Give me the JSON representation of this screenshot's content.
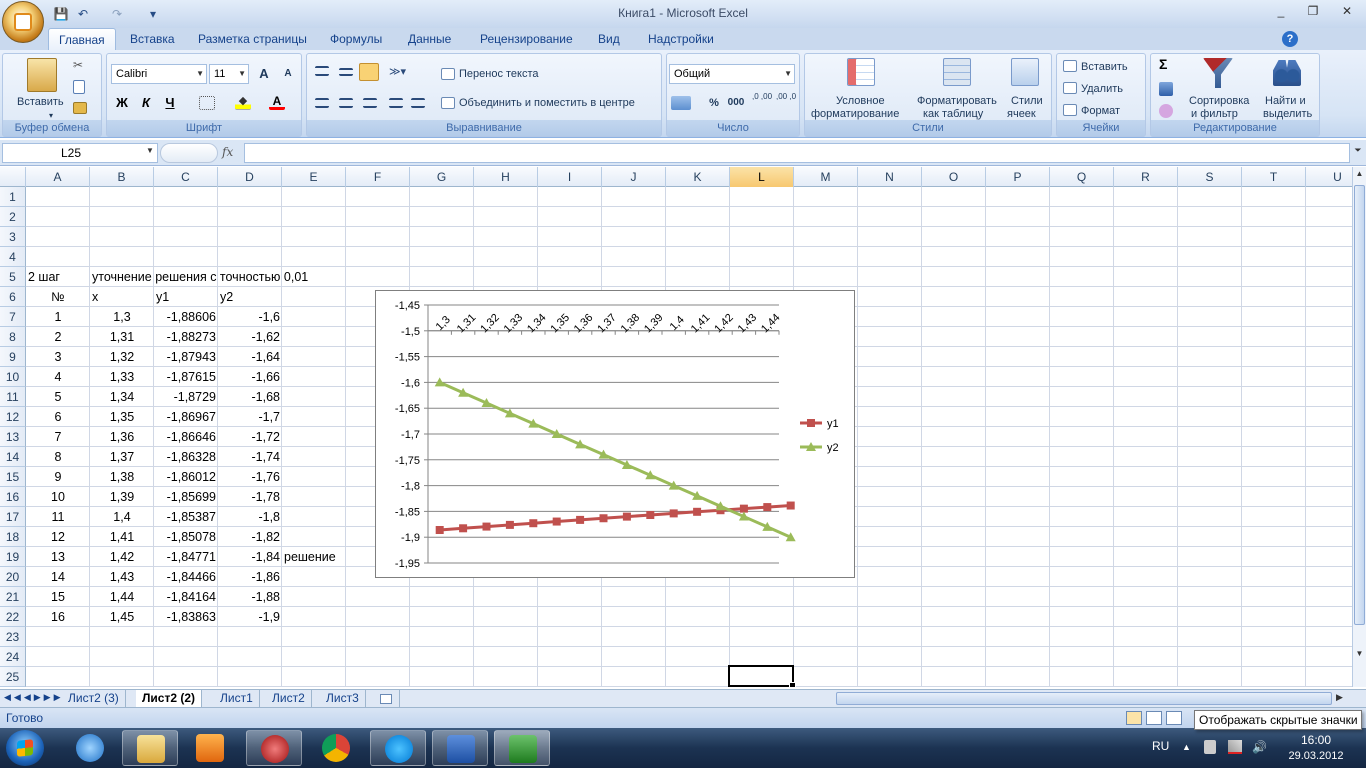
{
  "window": {
    "title": "Книга1 - Microsoft Excel",
    "minimize": "_",
    "restore": "❐",
    "close": "✕"
  },
  "qat": {
    "save": "💾",
    "undo": "↶",
    "redo": "↷",
    "customize": "▾"
  },
  "tabs": [
    "Главная",
    "Вставка",
    "Разметка страницы",
    "Формулы",
    "Данные",
    "Рецензирование",
    "Вид",
    "Надстройки"
  ],
  "ribbon": {
    "clipboard": {
      "label": "Буфер обмена",
      "paste": "Вставить"
    },
    "font": {
      "label": "Шрифт",
      "name": "Calibri",
      "size": "11",
      "grow": "A",
      "shrink": "A",
      "bold": "Ж",
      "italic": "К",
      "underline": "Ч"
    },
    "alignment": {
      "label": "Выравнивание",
      "wrap": "Перенос текста",
      "merge": "Объединить и поместить в центре"
    },
    "number": {
      "label": "Число",
      "format": "Общий",
      "percent": "%",
      "thousands": "000",
      "inc": ",0 ,00",
      "dec": ",00 ,0"
    },
    "styles": {
      "label": "Стили",
      "conditional_1": "Условное",
      "conditional_2": "форматирование",
      "table_1": "Форматировать",
      "table_2": "как таблицу",
      "cell_1": "Стили",
      "cell_2": "ячеек"
    },
    "cells": {
      "label": "Ячейки",
      "insert": "Вставить",
      "delete": "Удалить",
      "format": "Формат"
    },
    "editing": {
      "label": "Редактирование",
      "sort_1": "Сортировка",
      "sort_2": "и фильтр",
      "find_1": "Найти и",
      "find_2": "выделить",
      "sigma": "Σ"
    }
  },
  "formula_bar": {
    "name_box": "L25",
    "fx": "fx",
    "formula": ""
  },
  "columns": [
    "A",
    "B",
    "C",
    "D",
    "E",
    "F",
    "G",
    "H",
    "I",
    "J",
    "K",
    "L",
    "M",
    "N",
    "O",
    "P",
    "Q",
    "R",
    "S",
    "T",
    "U"
  ],
  "rows": [
    "1",
    "2",
    "3",
    "4",
    "5",
    "6",
    "7",
    "8",
    "9",
    "10",
    "11",
    "12",
    "13",
    "14",
    "15",
    "16",
    "17",
    "18",
    "19",
    "20",
    "21",
    "22",
    "23",
    "24",
    "25"
  ],
  "selected_column": "L",
  "sheet": {
    "a5": "2 шаг",
    "b5": "уточнение решения с точностью 0,01",
    "h_no": "№",
    "h_x": "x",
    "h_y1": "y1",
    "h_y2": "y2",
    "table": [
      [
        "1",
        "1,3",
        "-1,88606",
        "-1,6"
      ],
      [
        "2",
        "1,31",
        "-1,88273",
        "-1,62"
      ],
      [
        "3",
        "1,32",
        "-1,87943",
        "-1,64"
      ],
      [
        "4",
        "1,33",
        "-1,87615",
        "-1,66"
      ],
      [
        "5",
        "1,34",
        "-1,8729",
        "-1,68"
      ],
      [
        "6",
        "1,35",
        "-1,86967",
        "-1,7"
      ],
      [
        "7",
        "1,36",
        "-1,86646",
        "-1,72"
      ],
      [
        "8",
        "1,37",
        "-1,86328",
        "-1,74"
      ],
      [
        "9",
        "1,38",
        "-1,86012",
        "-1,76"
      ],
      [
        "10",
        "1,39",
        "-1,85699",
        "-1,78"
      ],
      [
        "11",
        "1,4",
        "-1,85387",
        "-1,8"
      ],
      [
        "12",
        "1,41",
        "-1,85078",
        "-1,82"
      ],
      [
        "13",
        "1,42",
        "-1,84771",
        "-1,84"
      ],
      [
        "14",
        "1,43",
        "-1,84466",
        "-1,86"
      ],
      [
        "15",
        "1,44",
        "-1,84164",
        "-1,88"
      ],
      [
        "16",
        "1,45",
        "-1,83863",
        "-1,9"
      ]
    ],
    "e19": "решение"
  },
  "chart_data": {
    "type": "line",
    "title": "",
    "xlabel": "",
    "ylabel": "",
    "categories": [
      "1,3",
      "1,31",
      "1,32",
      "1,33",
      "1,34",
      "1,35",
      "1,36",
      "1,37",
      "1,38",
      "1,39",
      "1,4",
      "1,41",
      "1,42",
      "1,43",
      "1,44"
    ],
    "series": [
      {
        "name": "y1",
        "color": "#c0504d",
        "marker": "square",
        "values": [
          -1.88606,
          -1.88273,
          -1.87943,
          -1.87615,
          -1.8729,
          -1.86967,
          -1.86646,
          -1.86328,
          -1.86012,
          -1.85699,
          -1.85387,
          -1.85078,
          -1.84771,
          -1.84466,
          -1.84164,
          -1.83863
        ]
      },
      {
        "name": "y2",
        "color": "#9bbb59",
        "marker": "triangle",
        "values": [
          -1.6,
          -1.62,
          -1.64,
          -1.66,
          -1.68,
          -1.7,
          -1.72,
          -1.74,
          -1.76,
          -1.78,
          -1.8,
          -1.82,
          -1.84,
          -1.86,
          -1.88,
          -1.9
        ]
      }
    ],
    "ylim": [
      -1.95,
      -1.45
    ],
    "ytick_step": 0.05,
    "yticks": [
      "-1,45",
      "-1,5",
      "-1,55",
      "-1,6",
      "-1,65",
      "-1,7",
      "-1,75",
      "-1,8",
      "-1,85",
      "-1,9",
      "-1,95"
    ],
    "grid": true,
    "x_axis_position": "top",
    "legend": "right"
  },
  "sheet_tabs": [
    "Лист2 (3)",
    "Лист2 (2)",
    "Лист1",
    "Лист2",
    "Лист3"
  ],
  "active_sheet": "Лист2 (2)",
  "status": {
    "ready": "Готово",
    "tooltip": "Отображать скрытые значки"
  },
  "taskbar": {
    "lang": "RU",
    "time": "16:00",
    "date": "29.03.2012"
  }
}
